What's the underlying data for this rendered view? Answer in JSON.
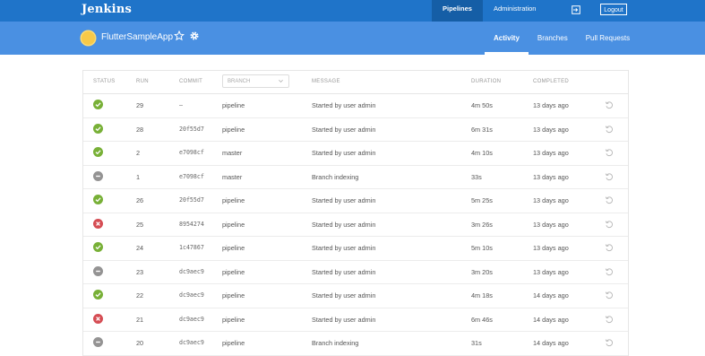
{
  "header": {
    "brand": "Jenkins",
    "nav": [
      {
        "label": "Pipelines",
        "active": true
      },
      {
        "label": "Administration",
        "active": false
      }
    ],
    "logout_label": "Logout"
  },
  "pipeline": {
    "name": "FlutterSampleApp",
    "tabs": [
      {
        "label": "Activity",
        "active": true
      },
      {
        "label": "Branches",
        "active": false
      },
      {
        "label": "Pull Requests",
        "active": false
      }
    ]
  },
  "table": {
    "columns": {
      "status": "STATUS",
      "run": "RUN",
      "commit": "COMMIT",
      "branch": "BRANCH",
      "message": "MESSAGE",
      "duration": "DURATION",
      "completed": "COMPLETED"
    },
    "rows": [
      {
        "status": "success",
        "run": "29",
        "commit": "–",
        "branch": "pipeline",
        "message": "Started by user admin",
        "duration": "4m 50s",
        "completed": "13 days ago"
      },
      {
        "status": "success",
        "run": "28",
        "commit": "20f55d7",
        "branch": "pipeline",
        "message": "Started by user admin",
        "duration": "6m 31s",
        "completed": "13 days ago"
      },
      {
        "status": "success",
        "run": "2",
        "commit": "e7098cf",
        "branch": "master",
        "message": "Started by user admin",
        "duration": "4m 10s",
        "completed": "13 days ago"
      },
      {
        "status": "aborted",
        "run": "1",
        "commit": "e7098cf",
        "branch": "master",
        "message": "Branch indexing",
        "duration": "33s",
        "completed": "13 days ago"
      },
      {
        "status": "success",
        "run": "26",
        "commit": "20f55d7",
        "branch": "pipeline",
        "message": "Started by user admin",
        "duration": "5m 25s",
        "completed": "13 days ago"
      },
      {
        "status": "failure",
        "run": "25",
        "commit": "8954274",
        "branch": "pipeline",
        "message": "Started by user admin",
        "duration": "3m 26s",
        "completed": "13 days ago"
      },
      {
        "status": "success",
        "run": "24",
        "commit": "1c47867",
        "branch": "pipeline",
        "message": "Started by user admin",
        "duration": "5m 10s",
        "completed": "13 days ago"
      },
      {
        "status": "aborted",
        "run": "23",
        "commit": "dc9aec9",
        "branch": "pipeline",
        "message": "Started by user admin",
        "duration": "3m 20s",
        "completed": "13 days ago"
      },
      {
        "status": "success",
        "run": "22",
        "commit": "dc9aec9",
        "branch": "pipeline",
        "message": "Started by user admin",
        "duration": "4m 18s",
        "completed": "14 days ago"
      },
      {
        "status": "failure",
        "run": "21",
        "commit": "dc9aec9",
        "branch": "pipeline",
        "message": "Started by user admin",
        "duration": "6m 46s",
        "completed": "14 days ago"
      },
      {
        "status": "aborted",
        "run": "20",
        "commit": "dc9aec9",
        "branch": "pipeline",
        "message": "Branch indexing",
        "duration": "31s",
        "completed": "14 days ago"
      }
    ]
  },
  "colors": {
    "topbar": "#1f74c9",
    "subbar": "#4a90e2",
    "success": "#78b037",
    "failure": "#d54c53",
    "aborted": "#949393"
  }
}
